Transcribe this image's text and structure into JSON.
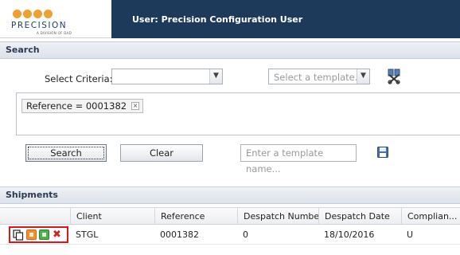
{
  "header": {
    "logo_text": "PRECISION",
    "logo_subtext": "A DIVISION OF DAD",
    "user_title": "User: Precision Configuration User"
  },
  "search": {
    "section_title": "Search",
    "criteria_label": "Select Criteria:",
    "criteria_value": "",
    "template_placeholder": "Select a template.",
    "tag_text": "Reference = 0001382",
    "search_button": "Search",
    "clear_button": "Clear",
    "template_name_placeholder": "Enter a template name..."
  },
  "shipments": {
    "section_title": "Shipments",
    "columns": [
      "",
      "Client",
      "Reference",
      "Despatch Number",
      "Despatch Date",
      "Complian..."
    ],
    "rows": [
      {
        "client": "STGL",
        "reference": "0001382",
        "despatch_number": "0",
        "despatch_date": "18/10/2016",
        "compliance": "U"
      }
    ]
  },
  "colors": {
    "header_bar": "#1e3a5a",
    "logo_dots": "#f0a030",
    "highlight_border": "#e0161d"
  },
  "icons": [
    "tools-icon",
    "save-icon",
    "copy-icon",
    "edit-icon",
    "view-icon",
    "delete-icon",
    "tag-remove-icon",
    "chevron-down-icon"
  ]
}
